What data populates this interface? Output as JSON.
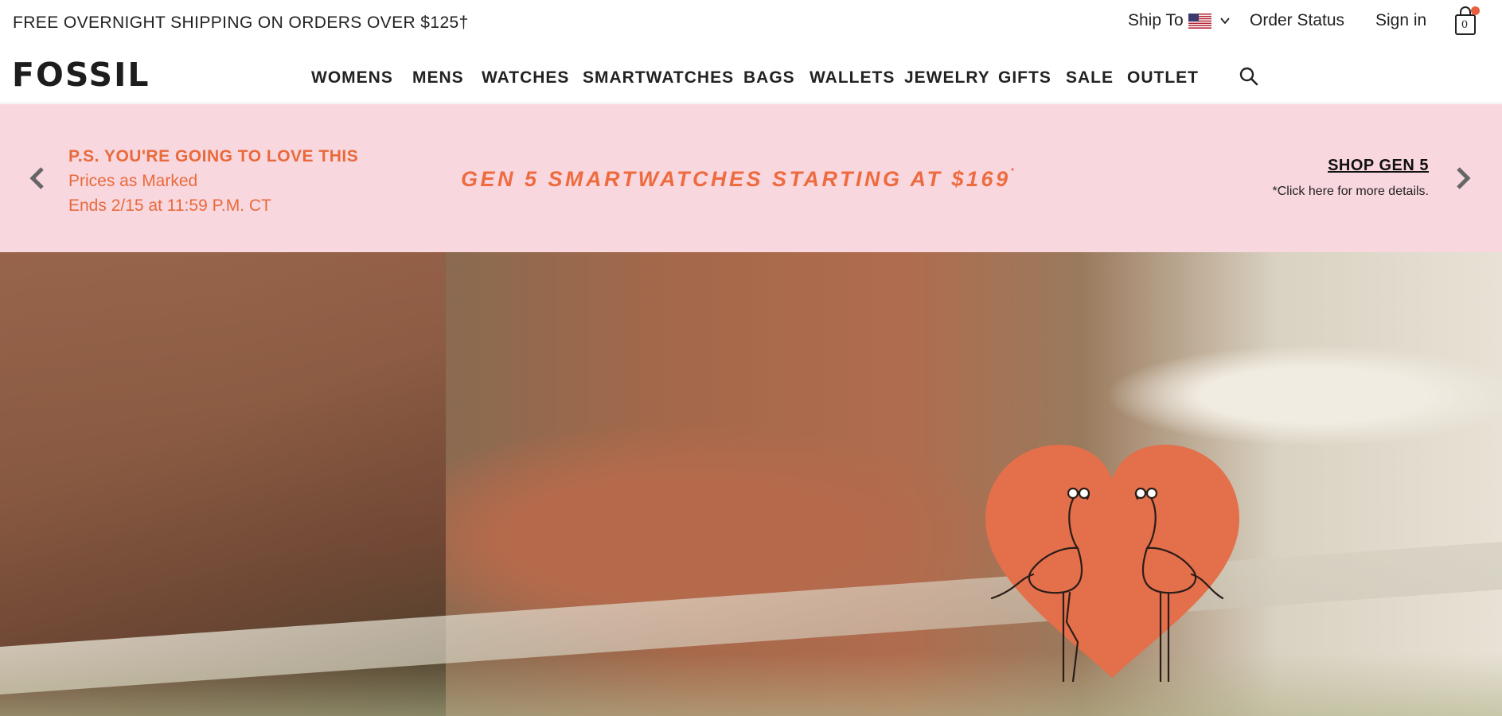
{
  "utility": {
    "free_shipping": "FREE OVERNIGHT SHIPPING ON ORDERS OVER $125†",
    "ship_to": "Ship To",
    "order_status": "Order Status",
    "sign_in": "Sign in",
    "bag_count": "0"
  },
  "brand": {
    "logo": "FOSSIL"
  },
  "nav": {
    "items": [
      "WOMENS",
      "MENS",
      "WATCHES",
      "SMARTWATCHES",
      "BAGS",
      "WALLETS",
      "JEWELRY",
      "GIFTS",
      "SALE",
      "OUTLET"
    ]
  },
  "promo": {
    "heading": "P.S. YOU'RE GOING TO LOVE THIS",
    "line1": "Prices as Marked",
    "line2": "Ends 2/15 at 11:59 P.M. CT",
    "headline": "GEN 5 SMARTWATCHES STARTING AT $169",
    "headline_sup": "*",
    "cta": "SHOP GEN 5",
    "details": "*Click here for more details."
  },
  "colors": {
    "promo_bg": "#f9d7df",
    "promo_text": "#e86a3b",
    "heart": "#e36f4b",
    "cart_dot": "#e85f3d"
  },
  "icons": [
    "us-flag-icon",
    "chevron-down-icon",
    "shopping-bag-icon",
    "search-icon",
    "chevron-left-icon",
    "chevron-right-icon",
    "flamingo-heart-icon"
  ]
}
